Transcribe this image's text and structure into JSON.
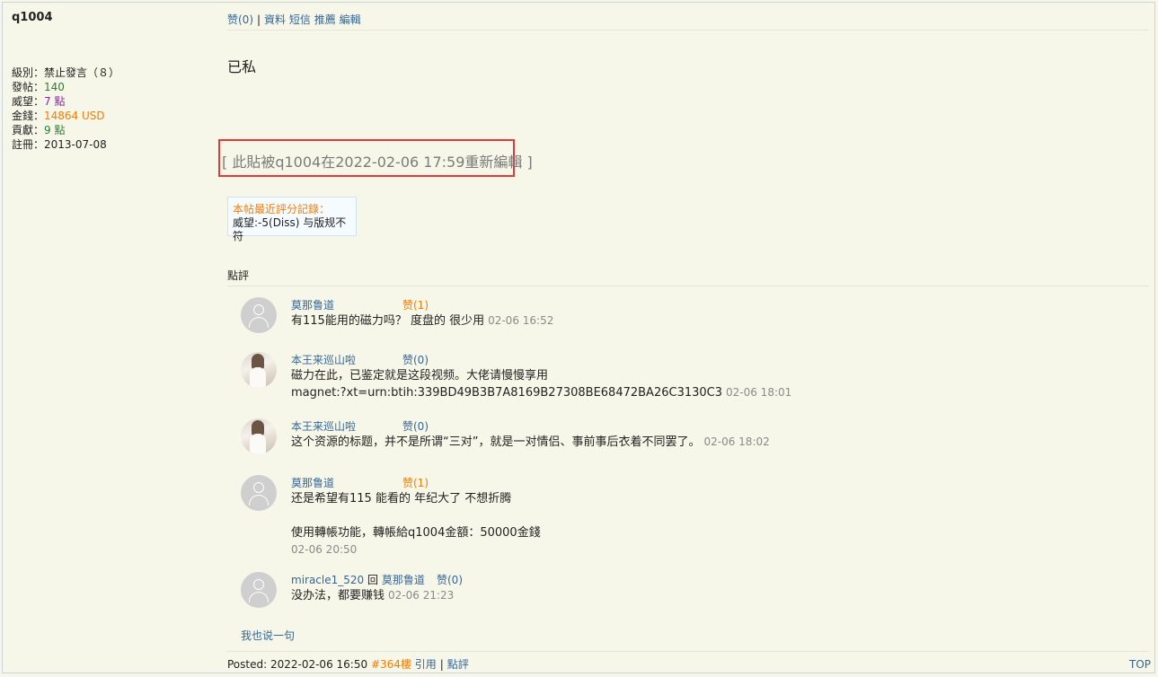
{
  "user": {
    "name": "q1004",
    "stats": [
      {
        "label": "級別：",
        "value": "禁止發言（８）",
        "color": "#222222"
      },
      {
        "label": "發帖：",
        "value": "140",
        "color": "#2e7d32"
      },
      {
        "label": "威望：",
        "value": "7 點",
        "color": "#8e24aa"
      },
      {
        "label": "金錢：",
        "value": "14864 USD",
        "color": "#f57c00"
      },
      {
        "label": "貢獻：",
        "value": "9 點",
        "color": "#2e7d32"
      },
      {
        "label": "註冊：",
        "value": "2013-07-08",
        "color": "#222222"
      }
    ]
  },
  "topbar": {
    "like": "赞(0)",
    "sep": "|",
    "profile": "資料",
    "message": "短信",
    "recommend": "推薦",
    "edit": "編輯"
  },
  "post": {
    "content": "已私",
    "edit_note": "[ 此貼被q1004在2022-02-06 17:59重新編輯 ]"
  },
  "rating": {
    "title": "本帖最近評分記錄：",
    "entry": "威望:-5(Diss) 与版规不符"
  },
  "comments_header": "點評",
  "comments": [
    {
      "user": "莫那鲁道",
      "like": "赞(1)",
      "lines": [
        "有115能用的磁力吗？  度盘的  很少用"
      ],
      "time": "02-06 16:52"
    },
    {
      "user": "本王来巡山啦",
      "like": "赞(0)",
      "lines": [
        "磁力在此，已鉴定就是这段视频。大佬请慢慢享用",
        "magnet:?xt=urn:btih:339BD49B3B7A8169B27308BE68472BA26C3130C3"
      ],
      "time": "02-06 18:01"
    },
    {
      "user": "本王来巡山啦",
      "like": "赞(0)",
      "lines": [
        "这个资源的标题，并不是所谓“三对”，就是一对情侣、事前事后衣着不同罢了。"
      ],
      "time": "02-06 18:02"
    },
    {
      "user": "莫那鲁道",
      "like": "赞(1)",
      "lines": [
        "还是希望有115 能看的   年纪大了 不想折腾",
        "",
        "使用轉帳功能，轉帳給q1004金額：50000金錢"
      ],
      "time": "02-06 20:50"
    },
    {
      "user": "miracle1_520",
      "reply_word": "回",
      "reply_to": "莫那鲁道",
      "like": "赞(0)",
      "lines": [
        "没办法，都要赚钱"
      ],
      "time": "02-06 21:23"
    }
  ],
  "say_something": "我也说一句",
  "footer": {
    "posted": "Posted: 2022-02-06 16:50",
    "floor": "#364樓",
    "quote": "引用",
    "sep": "|",
    "comment": "點評",
    "top": "TOP"
  },
  "colors": {
    "background": "#f7f7e9",
    "link": "#336699",
    "accent_orange": "#f57c00",
    "highlight_border": "#e53935"
  }
}
